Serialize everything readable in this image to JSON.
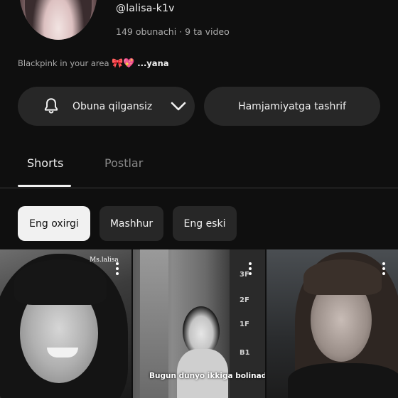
{
  "channel": {
    "handle": "@lalisa-k1v",
    "subscribers": "149 obunachi",
    "separator": "·",
    "videos": "9 ta video",
    "bio_text": "Blackpink in your area",
    "bio_emojis": "🎀💖",
    "bio_more": "...yana"
  },
  "actions": {
    "subscribe_label": "Obuna qilgansiz",
    "community_label": "Hamjamiyatga tashrif"
  },
  "tabs": [
    {
      "label": "Shorts",
      "active": true
    },
    {
      "label": "Postlar",
      "active": false
    }
  ],
  "filters": [
    {
      "label": "Eng oxirgi",
      "selected": true
    },
    {
      "label": "Mashhur",
      "selected": false
    },
    {
      "label": "Eng eski",
      "selected": false
    }
  ],
  "shorts": [
    {
      "watermark": "Ms.lalisa",
      "caption": ""
    },
    {
      "watermark": "",
      "caption": "Bugun dunyo ikkiga bolinadi...",
      "floors": [
        "3F",
        "2F",
        "1F",
        "B1"
      ]
    },
    {
      "watermark": "",
      "caption": ""
    }
  ],
  "colors": {
    "background": "#0f0f0f",
    "button_bg": "#272727",
    "selected_chip_bg": "#f1f1f1",
    "text_primary": "#f1f1f1",
    "text_secondary": "#aaaaaa"
  }
}
